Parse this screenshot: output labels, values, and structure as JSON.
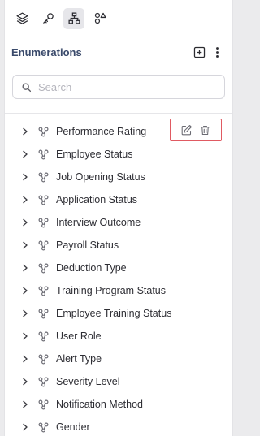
{
  "toolbar": {
    "icons": [
      "layers-icon",
      "key-icon",
      "hierarchy-icon",
      "shapes-icon"
    ]
  },
  "header": {
    "title": "Enumerations"
  },
  "search": {
    "placeholder": "Search",
    "value": ""
  },
  "tree": {
    "items": [
      {
        "label": "Performance Rating"
      },
      {
        "label": "Employee Status"
      },
      {
        "label": "Job Opening Status"
      },
      {
        "label": "Application Status"
      },
      {
        "label": "Interview Outcome"
      },
      {
        "label": "Payroll Status"
      },
      {
        "label": "Deduction Type"
      },
      {
        "label": "Training Program Status"
      },
      {
        "label": "Employee Training Status"
      },
      {
        "label": "User Role"
      },
      {
        "label": "Alert Type"
      },
      {
        "label": "Severity Level"
      },
      {
        "label": "Notification Method"
      },
      {
        "label": "Gender"
      }
    ]
  },
  "colors": {
    "title": "#3a4a6b",
    "highlight_border": "#e05a62",
    "active_tab_bg": "#e6e6ea"
  }
}
